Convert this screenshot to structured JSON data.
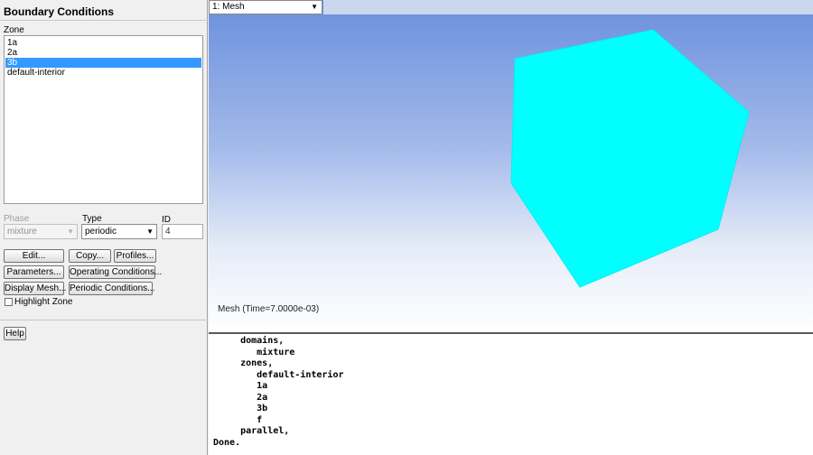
{
  "panel": {
    "title": "Boundary Conditions",
    "zone_label": "Zone",
    "zones": [
      "1a",
      "2a",
      "3b",
      "default-interior"
    ],
    "selected_zone": "3b",
    "phase_label": "Phase",
    "phase_value": "mixture",
    "type_label": "Type",
    "type_value": "periodic",
    "id_label": "ID",
    "id_value": "4",
    "buttons": {
      "edit": "Edit...",
      "copy": "Copy...",
      "profiles": "Profiles...",
      "parameters": "Parameters...",
      "operating_conditions": "Operating Conditions...",
      "display_mesh": "Display Mesh...",
      "periodic_conditions": "Periodic Conditions..."
    },
    "highlight_zone_label": "Highlight Zone",
    "highlight_zone_checked": false,
    "help": "Help"
  },
  "graphics": {
    "view_select": "1: Mesh",
    "caption": "Mesh  (Time=7.0000e-03)",
    "mesh_color": "#00ffff"
  },
  "console": {
    "lines": [
      "     domains,",
      "        mixture",
      "     zones,",
      "        default-interior",
      "        1a",
      "        2a",
      "        3b",
      "        f",
      "     parallel,",
      "Done."
    ]
  }
}
